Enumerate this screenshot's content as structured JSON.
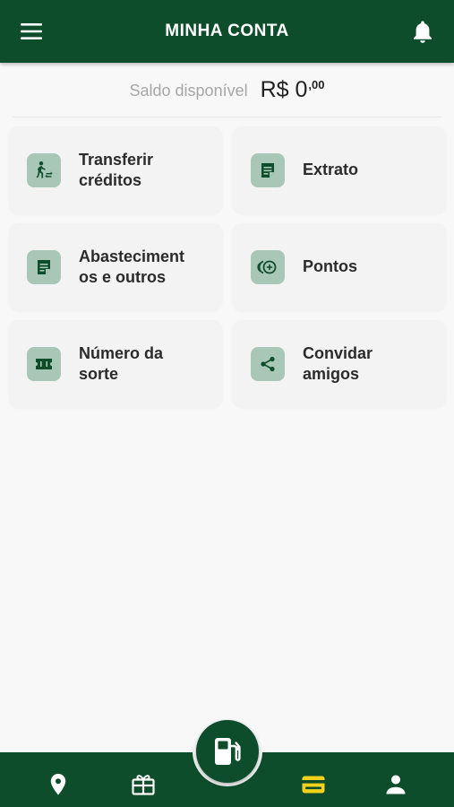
{
  "header": {
    "title": "MINHA CONTA",
    "menu_icon": "hamburger-menu-icon",
    "bell_icon": "bell-icon"
  },
  "balance": {
    "label": "Saldo disponível",
    "amount": "R$ 0",
    "cents": ",00"
  },
  "cards": [
    {
      "label": "Transferir\ncréditos",
      "icon": "person-transfer-icon"
    },
    {
      "label": "Extrato",
      "icon": "document-icon"
    },
    {
      "label": "Abasteciment\nos e outros",
      "icon": "document-icon"
    },
    {
      "label": "Pontos",
      "icon": "points-icon"
    },
    {
      "label": "Número da\nsorte",
      "icon": "ticket-icon"
    },
    {
      "label": "Convidar\namigos",
      "icon": "share-icon"
    }
  ],
  "bottom_nav": {
    "items": [
      {
        "name": "location",
        "icon": "location-pin-icon"
      },
      {
        "name": "gift",
        "icon": "gift-icon"
      },
      {
        "name": "fuel",
        "icon": "fuel-pump-icon"
      },
      {
        "name": "wallet",
        "icon": "wallet-card-icon",
        "active": true
      },
      {
        "name": "profile",
        "icon": "person-icon"
      }
    ]
  },
  "colors": {
    "primary": "#0e4d2b",
    "icon_bg": "#a9c7b6",
    "active_nav": "#f2d21c",
    "background": "#f8f8f8"
  }
}
